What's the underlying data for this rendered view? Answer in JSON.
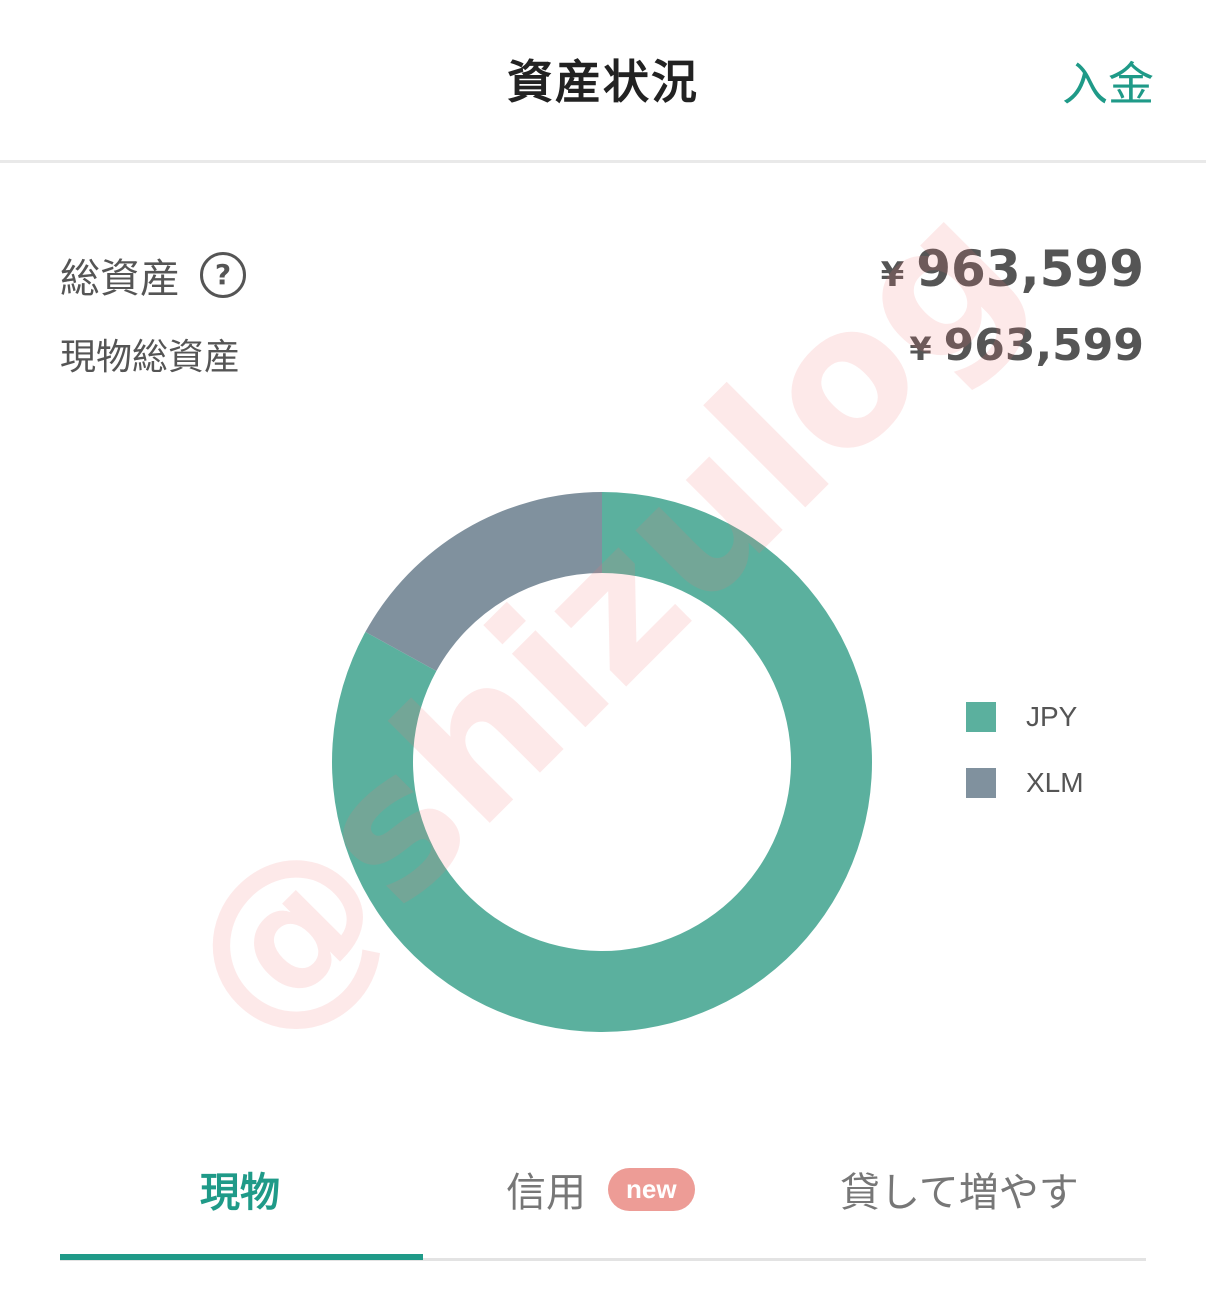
{
  "header": {
    "title": "資産状況",
    "deposit_label": "入金"
  },
  "summary": {
    "total_label": "総資産",
    "help_symbol": "?",
    "total_currency": "¥",
    "total_value": "963,599",
    "spot_label": "現物総資産",
    "spot_currency": "¥",
    "spot_value": "963,599"
  },
  "colors": {
    "accent": "#1f9a88",
    "jpy": "#5bb09e",
    "xlm": "#80919e",
    "badge": "#ed9c96"
  },
  "chart_data": {
    "type": "pie",
    "donut": true,
    "categories": [
      "JPY",
      "XLM"
    ],
    "values": [
      83,
      17
    ],
    "colors": [
      "#5bb09e",
      "#80919e"
    ],
    "legend_position": "right"
  },
  "watermark": "@shizulog",
  "tabs": [
    {
      "label": "現物",
      "active": true
    },
    {
      "label": "信用",
      "badge": "new",
      "active": false
    },
    {
      "label": "貸して増やす",
      "active": false
    }
  ]
}
